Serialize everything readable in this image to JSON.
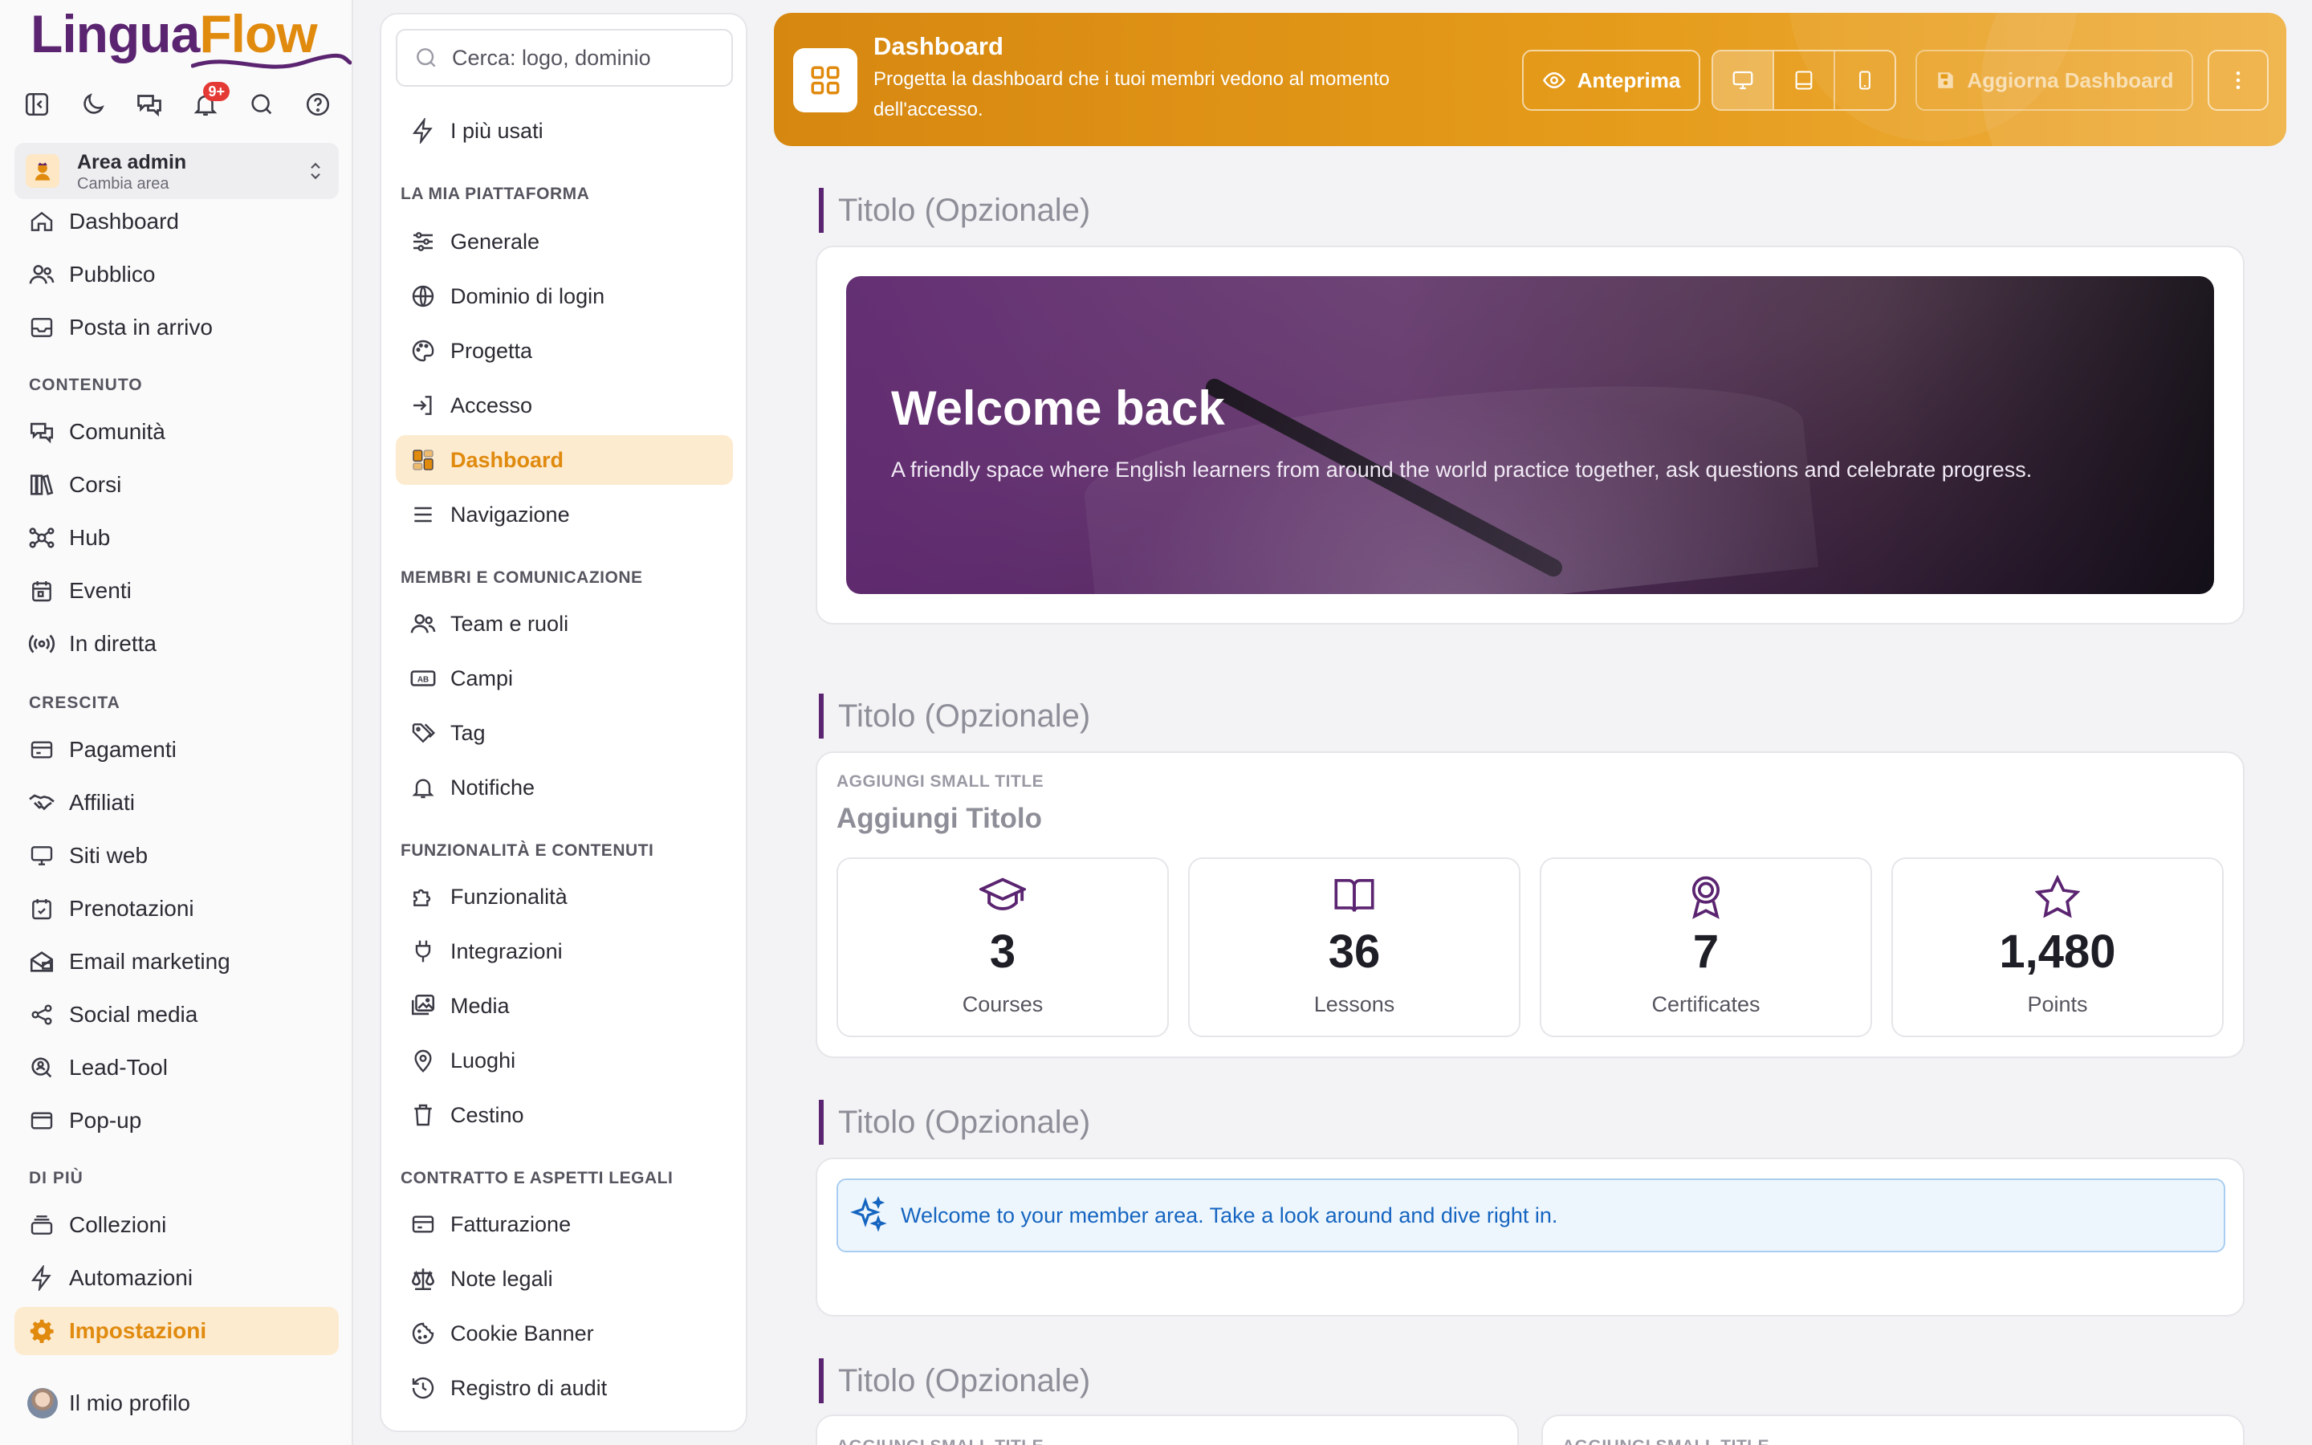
{
  "app": {
    "logo_part1": "Lingua",
    "logo_part2": "Flow"
  },
  "toolbar": {
    "notifications_badge": "9+"
  },
  "area": {
    "title": "Area admin",
    "subtitle": "Cambia area"
  },
  "nav": {
    "top": [
      {
        "label": "Dashboard",
        "icon": "home-icon"
      },
      {
        "label": "Pubblico",
        "icon": "users-icon"
      },
      {
        "label": "Posta in arrivo",
        "icon": "inbox-icon"
      }
    ],
    "sections": [
      {
        "title": "CONTENUTO",
        "items": [
          {
            "label": "Comunità",
            "icon": "chat-icon"
          },
          {
            "label": "Corsi",
            "icon": "books-icon"
          },
          {
            "label": "Hub",
            "icon": "hub-icon"
          },
          {
            "label": "Eventi",
            "icon": "calendar-icon"
          },
          {
            "label": "In diretta",
            "icon": "live-icon"
          }
        ]
      },
      {
        "title": "CRESCITA",
        "items": [
          {
            "label": "Pagamenti",
            "icon": "payment-icon"
          },
          {
            "label": "Affiliati",
            "icon": "handshake-icon"
          },
          {
            "label": "Siti web",
            "icon": "monitor-icon"
          },
          {
            "label": "Prenotazioni",
            "icon": "booking-icon"
          },
          {
            "label": "Email marketing",
            "icon": "email-icon"
          },
          {
            "label": "Social media",
            "icon": "share-icon"
          },
          {
            "label": "Lead-Tool",
            "icon": "lead-icon"
          },
          {
            "label": "Pop-up",
            "icon": "popup-icon"
          }
        ]
      },
      {
        "title": "DI PIÙ",
        "items": [
          {
            "label": "Collezioni",
            "icon": "collection-icon"
          },
          {
            "label": "Automazioni",
            "icon": "bolt-icon"
          },
          {
            "label": "Impostazioni",
            "icon": "gear-icon",
            "active": true
          }
        ]
      }
    ],
    "profile": "Il mio profilo"
  },
  "settings": {
    "search_placeholder": "Cerca: logo, dominio",
    "most_used": "I più usati",
    "sections": [
      {
        "title": "LA MIA PIATTAFORMA",
        "items": [
          "Generale",
          "Dominio di login",
          "Progetta",
          "Accesso",
          "Dashboard",
          "Navigazione"
        ]
      },
      {
        "title": "MEMBRI E COMUNICAZIONE",
        "items": [
          "Team e ruoli",
          "Campi",
          "Tag",
          "Notifiche"
        ]
      },
      {
        "title": "FUNZIONALITÀ E CONTENUTI",
        "items": [
          "Funzionalità",
          "Integrazioni",
          "Media",
          "Luoghi",
          "Cestino"
        ]
      },
      {
        "title": "CONTRATTO E ASPETTI LEGALI",
        "items": [
          "Fatturazione",
          "Note legali",
          "Cookie Banner",
          "Registro di audit"
        ]
      }
    ],
    "active": "Dashboard"
  },
  "banner": {
    "title": "Dashboard",
    "description": "Progetta la dashboard che i tuoi membri vedono al momento dell'accesso.",
    "preview_label": "Anteprima",
    "update_label": "Aggiorna Dashboard",
    "active_device": "desktop"
  },
  "sections": [
    {
      "title": "Titolo (Opzionale)"
    },
    {
      "title": "Titolo (Opzionale)"
    },
    {
      "title": "Titolo (Opzionale)"
    },
    {
      "title": "Titolo (Opzionale)"
    }
  ],
  "hero": {
    "heading": "Welcome back",
    "text": "A friendly space where English learners from around the world practice together, ask questions and celebrate progress."
  },
  "stats_block": {
    "small_title": "AGGIUNGI SMALL TITLE",
    "title": "Aggiungi Titolo",
    "stats": [
      {
        "value": "3",
        "label": "Courses",
        "icon": "graduation-cap-icon"
      },
      {
        "value": "36",
        "label": "Lessons",
        "icon": "open-book-icon"
      },
      {
        "value": "7",
        "label": "Certificates",
        "icon": "award-icon"
      },
      {
        "value": "1,480",
        "label": "Points",
        "icon": "star-icon"
      }
    ]
  },
  "welcome_note": "Welcome to your member area. Take a look around and dive right in.",
  "partial_small_title": "AGGIUNGI SMALL TITLE",
  "colors": {
    "accent": "#e08a0e",
    "brand": "#5b2470",
    "info": "#1565c0"
  }
}
